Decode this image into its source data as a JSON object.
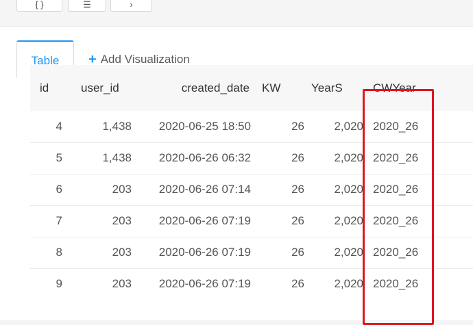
{
  "toolbar": {
    "buttons": [
      {
        "label": "{ }"
      },
      {
        "label": "☰"
      },
      {
        "label": "›"
      }
    ]
  },
  "tabs": {
    "active_label": "Table",
    "add_label": "Add Visualization"
  },
  "table": {
    "columns": [
      "id",
      "user_id",
      "created_date",
      "KW",
      "YearS",
      "CWYear"
    ],
    "rows": [
      [
        "4",
        "1,438",
        "2020-06-25 18:50",
        "26",
        "2,020",
        "2020_26"
      ],
      [
        "5",
        "1,438",
        "2020-06-26 06:32",
        "26",
        "2,020",
        "2020_26"
      ],
      [
        "6",
        "203",
        "2020-06-26 07:14",
        "26",
        "2,020",
        "2020_26"
      ],
      [
        "7",
        "203",
        "2020-06-26 07:19",
        "26",
        "2,020",
        "2020_26"
      ],
      [
        "8",
        "203",
        "2020-06-26 07:19",
        "26",
        "2,020",
        "2020_26"
      ],
      [
        "9",
        "203",
        "2020-06-26 07:19",
        "26",
        "2,020",
        "2020_26"
      ]
    ]
  },
  "colors": {
    "accent": "#2196f3",
    "highlight": "#e0141e"
  }
}
